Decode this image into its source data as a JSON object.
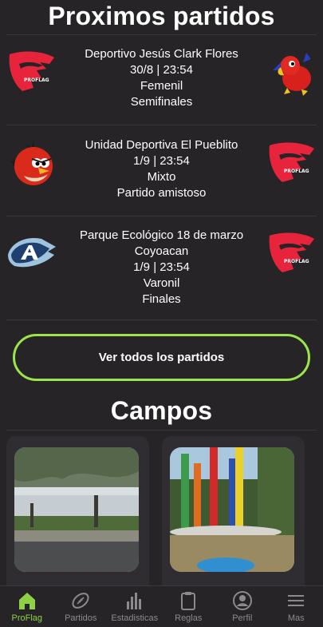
{
  "upcoming": {
    "title": "Proximos partidos",
    "matches": [
      {
        "venue": "Deportivo Jesús Clark Flores",
        "venue2": "",
        "date": "30/8",
        "time": "23:54",
        "category": "Femenil",
        "stage": "Semifinales",
        "home_logo": "proflag-wing-logo",
        "away_logo": "red-parrot-mascot-logo"
      },
      {
        "venue": "Unidad Deportiva El Pueblito",
        "venue2": "",
        "date": "1/9",
        "time": "23:54",
        "category": "Mixto",
        "stage": "Partido amistoso",
        "home_logo": "angry-red-bird-logo",
        "away_logo": "proflag-wing-logo"
      },
      {
        "venue": "Parque Ecológico 18 de marzo",
        "venue2": "Coyoacan",
        "date": "1/9",
        "time": "23:54",
        "category": "Varonil",
        "stage": "Finales",
        "home_logo": "blue-a-logo",
        "away_logo": "proflag-wing-logo"
      }
    ],
    "view_all_label": "Ver todos los partidos"
  },
  "fields": {
    "title": "Campos",
    "cards": [
      {
        "image": "park-trees-photo"
      },
      {
        "image": "colored-pillars-photo"
      }
    ]
  },
  "nav": {
    "items": [
      {
        "label": "ProFlag",
        "icon": "home-icon",
        "active": true
      },
      {
        "label": "Partidos",
        "icon": "football-icon",
        "active": false
      },
      {
        "label": "Estadisticas",
        "icon": "bar-chart-icon",
        "active": false
      },
      {
        "label": "Reglas",
        "icon": "clipboard-icon",
        "active": false
      },
      {
        "label": "Perfil",
        "icon": "profile-icon",
        "active": false
      },
      {
        "label": "Mas",
        "icon": "menu-icon",
        "active": false
      }
    ]
  },
  "colors": {
    "background": "#262427",
    "accent": "#9be44a",
    "nav_active": "#8fd144",
    "nav_inactive": "#8b8a8c",
    "card": "#2f2d31",
    "logo_red": "#e8243c"
  }
}
